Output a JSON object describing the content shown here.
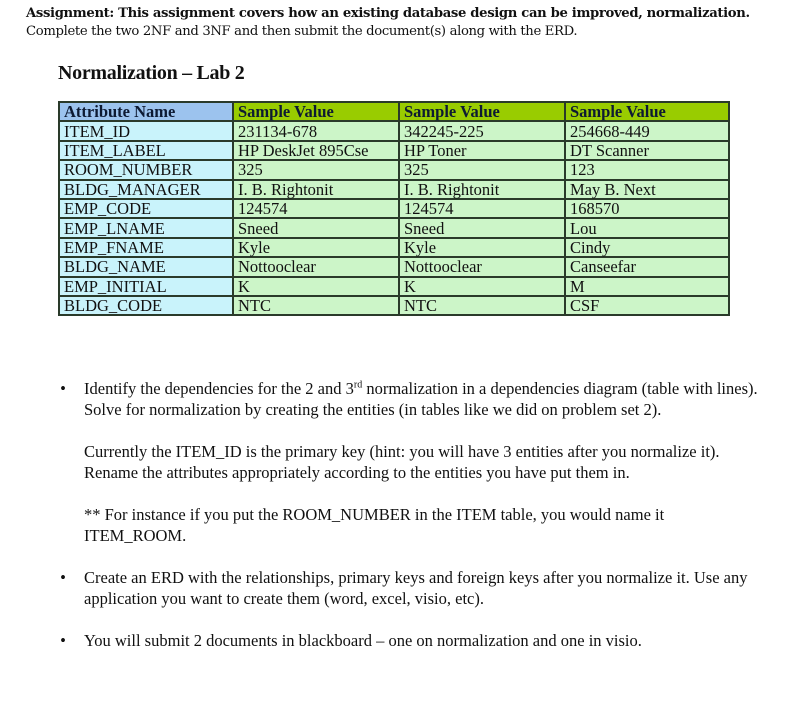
{
  "header": {
    "line1_bold": "Assignment: This assignment covers how an existing database design can be improved, normalization.",
    "line2": "Complete the two 2NF and 3NF and then submit the document(s) along with the ERD."
  },
  "lab_title": "Normalization – Lab 2",
  "table": {
    "headers": [
      "Attribute Name",
      "Sample Value",
      "Sample Value",
      "Sample Value"
    ],
    "colors": {
      "attr_header": "#9cc3ee",
      "value_header": "#99cc00",
      "attr_cell": "#c9f3fb",
      "value_cell": "#ccf5c8"
    },
    "rows": [
      [
        "ITEM_ID",
        "231134-678",
        "342245-225",
        "254668-449"
      ],
      [
        "ITEM_LABEL",
        "HP DeskJet 895Cse",
        "HP Toner",
        "DT Scanner"
      ],
      [
        "ROOM_NUMBER",
        "325",
        "325",
        "123"
      ],
      [
        "BLDG_MANAGER",
        "I. B. Rightonit",
        "I. B. Rightonit",
        "May B. Next"
      ],
      [
        "EMP_CODE",
        "124574",
        "124574",
        "168570"
      ],
      [
        "EMP_LNAME",
        "Sneed",
        "Sneed",
        "Lou"
      ],
      [
        "EMP_FNAME",
        "Kyle",
        "Kyle",
        "Cindy"
      ],
      [
        "BLDG_NAME",
        "Nottooclear",
        "Nottooclear",
        "Canseefar"
      ],
      [
        "EMP_INITIAL",
        "K",
        "K",
        "M"
      ],
      [
        "BLDG_CODE",
        "NTC",
        "NTC",
        "CSF"
      ]
    ]
  },
  "bullets": {
    "bullet_glyph": "•",
    "item1": {
      "text_a": "Identify the dependencies for the 2 and 3",
      "sup": "rd",
      "text_b": " normalization in a dependencies diagram (table with lines).  Solve for normalization by creating the entities (in tables like we did on problem set 2).",
      "para2": "Currently the ITEM_ID is the primary key (hint:  you will have 3 entities after you normalize it).  Rename the attributes appropriately according to the entities you have put them in.",
      "para3": "**   For instance if you put the ROOM_NUMBER in the ITEM table, you would name it ITEM_ROOM."
    },
    "item2": "Create an ERD with the relationships, primary keys and foreign keys after you normalize it. Use any application you want to create them (word, excel, visio, etc).",
    "item3": "You will submit 2 documents in blackboard – one on normalization and one in visio."
  }
}
